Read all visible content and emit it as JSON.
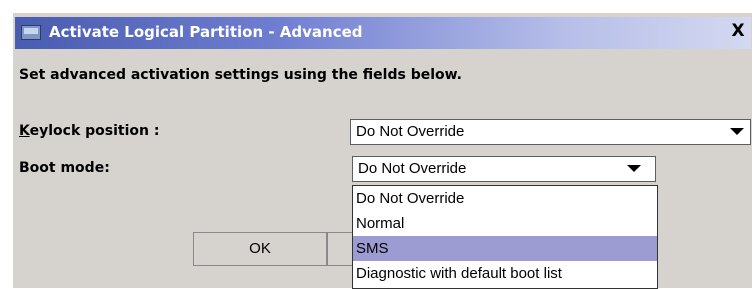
{
  "window": {
    "title": "Activate Logical Partition - Advanced",
    "close_label": "X"
  },
  "instructions": "Set advanced activation settings using the fields below.",
  "fields": {
    "keylock": {
      "label_mnemonic": "K",
      "label_rest": "eylock position :",
      "value": "Do Not Override"
    },
    "boot_mode": {
      "label": "Boot mode:",
      "value": "Do Not Override",
      "options": [
        "Do Not Override",
        "Normal",
        "SMS",
        "Diagnostic with default boot list"
      ],
      "highlighted_option": "SMS"
    }
  },
  "buttons": {
    "ok_label": "OK"
  },
  "colors": {
    "title_gradient_start": "#4a5cb0",
    "dialog_background": "#d6d3ce",
    "highlight": "#9c9cd2"
  }
}
